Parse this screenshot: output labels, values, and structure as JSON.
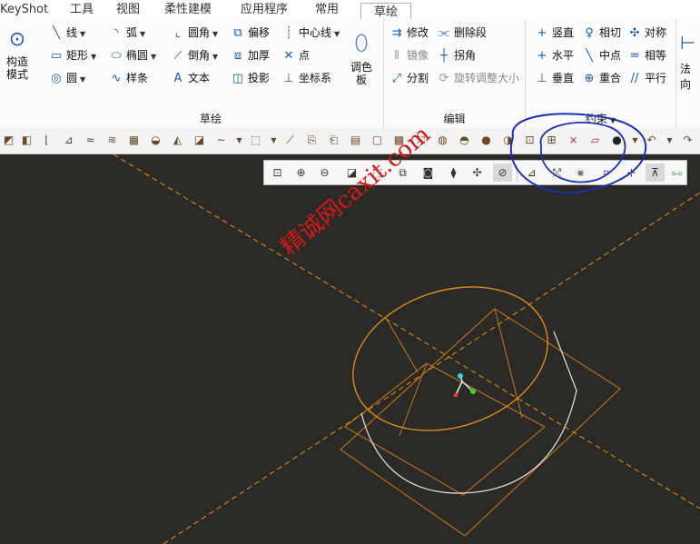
{
  "tabs": {
    "items": [
      "KeyShot",
      "工具",
      "视图",
      "柔性建模",
      "应用程序",
      "常用"
    ],
    "active": "草绘"
  },
  "ribbon": {
    "construct_mode": "构造\n模式",
    "sketch_group": {
      "label": "草绘",
      "col1": [
        "线",
        "矩形",
        "圆"
      ],
      "col2": [
        "弧",
        "椭圆",
        "样条"
      ],
      "col3": [
        "圆角",
        "倒角",
        "文本"
      ],
      "col4": [
        "偏移",
        "加厚",
        "投影"
      ],
      "col5": [
        "中心线",
        "点",
        "坐标系"
      ],
      "palette": "调色\n板"
    },
    "edit_group": {
      "label": "编辑",
      "col1": [
        "修改",
        "镜像",
        "分割"
      ],
      "col2": [
        "删除段",
        "拐角",
        "旋转调整大小"
      ]
    },
    "constrain_group": {
      "label": "约束",
      "col1": [
        "竖直",
        "水平",
        "垂直"
      ],
      "col2": [
        "相切",
        "中点",
        "重合"
      ],
      "col3": [
        "对称",
        "相等",
        "平行"
      ]
    },
    "right_partial": "法向"
  },
  "watermark": "精诚网caxit.com",
  "annotation_color": "#1f2fb0",
  "sketch_color": "#e8921e"
}
